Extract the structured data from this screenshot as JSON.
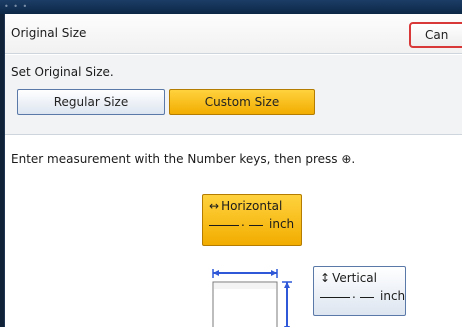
{
  "header": {
    "title": "Original Size",
    "cancel_label": "Can"
  },
  "size_section": {
    "label": "Set Original Size.",
    "regular_label": "Regular Size",
    "custom_label": "Custom Size"
  },
  "instruction": "Enter measurement with the Number keys, then press ⊕.",
  "horizontal": {
    "arrow": "↔",
    "label": "Horizontal",
    "dot": ".",
    "unit": "inch"
  },
  "vertical": {
    "arrow": "↕",
    "label": "Vertical",
    "dot": ".",
    "unit": "inch"
  },
  "colors": {
    "selected": "#f2ad00",
    "accent_blue": "#2e58d8",
    "cancel_border": "#d93838"
  }
}
